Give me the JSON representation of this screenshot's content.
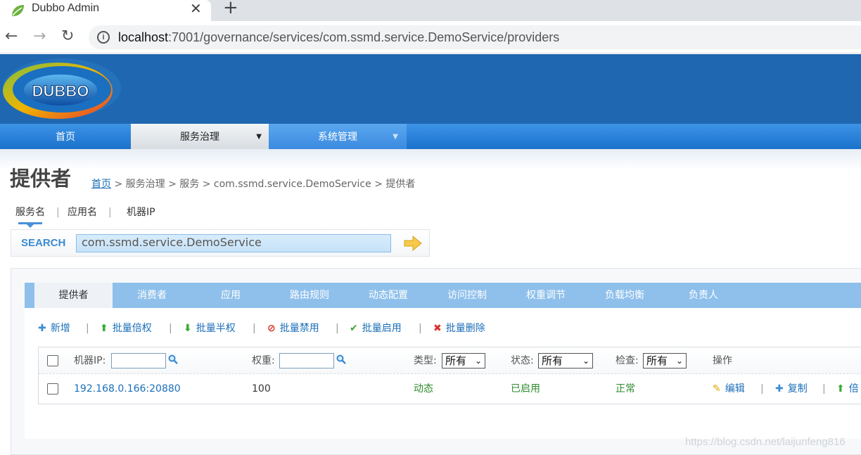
{
  "browser": {
    "tab_title": "Dubbo Admin",
    "close_glyph": "✕",
    "new_tab_glyph": "+",
    "back_glyph": "←",
    "forward_glyph": "→",
    "reload_glyph": "↻",
    "info_glyph": "i",
    "url_host": "localhost",
    "url_rest": ":7001/governance/services/com.ssmd.service.DemoService/providers"
  },
  "header": {
    "logo_text": "DUBBO",
    "nav": {
      "home": "首页",
      "governance": "服务治理",
      "system": "系统管理",
      "caret": "▼"
    }
  },
  "page": {
    "title": "提供者",
    "breadcrumb": {
      "home": "首页",
      "rest": " > 服务治理 > 服务 > com.ssmd.service.DemoService > 提供者"
    }
  },
  "search": {
    "tabs": [
      "服务名",
      "应用名",
      "机器IP"
    ],
    "separator": "|",
    "label": "SEARCH",
    "value": "com.ssmd.service.DemoService"
  },
  "sub_tabs": [
    "提供者",
    "消费者",
    "应用",
    "路由规则",
    "动态配置",
    "访问控制",
    "权重调节",
    "负载均衡",
    "负责人"
  ],
  "toolbar": {
    "separator": "|",
    "buttons": [
      {
        "icon": "plus-icon",
        "glyph": "✚",
        "label": "新增"
      },
      {
        "icon": "arrow-up-icon",
        "glyph": "⬆",
        "label": "批量倍权"
      },
      {
        "icon": "arrow-down-icon",
        "glyph": "⬇",
        "label": "批量半权"
      },
      {
        "icon": "ban-icon",
        "glyph": "⊘",
        "label": "批量禁用"
      },
      {
        "icon": "check-icon",
        "glyph": "✔",
        "label": "批量启用"
      },
      {
        "icon": "x-icon",
        "glyph": "✖",
        "label": "批量删除"
      }
    ]
  },
  "table": {
    "headers": {
      "ip": "机器IP:",
      "weight": "权重:",
      "type": "类型:",
      "status": "状态:",
      "check": "检查:",
      "ops": "操作"
    },
    "filters": {
      "type": "所有",
      "status": "所有",
      "check": "所有",
      "arrow": "⌄"
    },
    "rows": [
      {
        "ip": "192.168.0.166:20880",
        "weight": "100",
        "type": "动态",
        "status": "已启用",
        "check": "正常",
        "actions": [
          {
            "glyph": "✎",
            "label": "编辑"
          },
          {
            "glyph": "✚",
            "label": "复制"
          },
          {
            "glyph": "⬆",
            "label": "倍"
          }
        ]
      }
    ]
  },
  "watermark": "https://blog.csdn.net/laijunfeng816"
}
